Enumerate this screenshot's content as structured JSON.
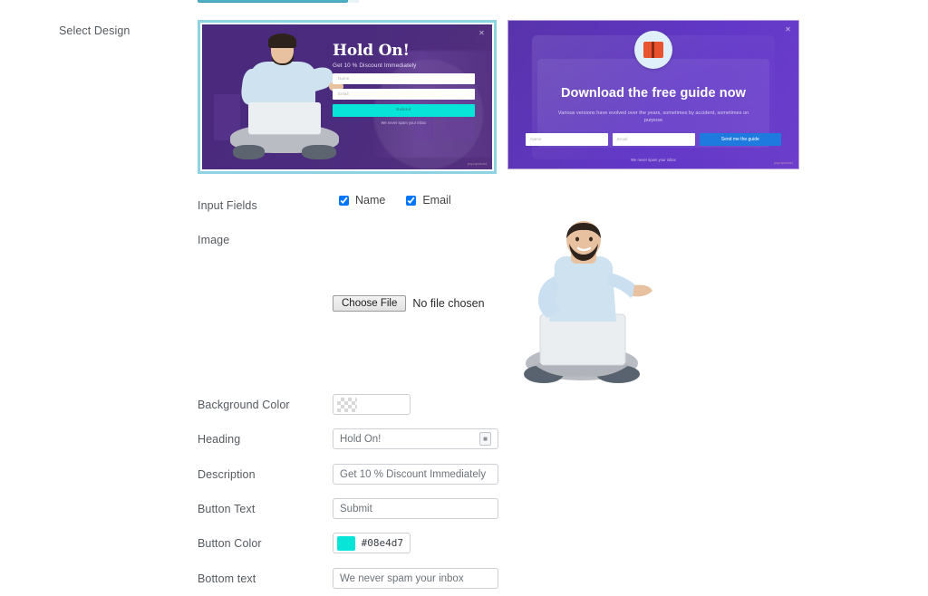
{
  "labels": {
    "select_design": "Select Design",
    "input_fields": "Input Fields",
    "image": "Image",
    "background_color": "Background Color",
    "heading": "Heading",
    "description": "Description",
    "button_text": "Button Text",
    "button_color": "Button Color",
    "bottom_text": "Bottom text"
  },
  "input_fields": {
    "name_label": "Name",
    "email_label": "Email",
    "name_checked": true,
    "email_checked": true
  },
  "image_upload": {
    "button_label": "Choose File",
    "status": "No file chosen",
    "preview_alt": "Man sitting cross-legged with laptop presenting with one hand"
  },
  "fields": {
    "background_color_value": "",
    "background_color_swatch": "transparent",
    "heading_value": "Hold On!",
    "heading_emoji_icon": "emoji-picker-icon",
    "description_value": "Get 10 % Discount Immediately",
    "button_text_value": "Submit",
    "button_color_value": "#08e4d7",
    "bottom_text_value": "We never spam your inbox"
  },
  "designs": [
    {
      "name": "design-1",
      "selected": true,
      "selection_color": "#8fd3e3",
      "background_color": "#4b2a7d",
      "heading": "Hold On!",
      "description": "Get 10 % Discount Immediately",
      "name_placeholder": "Name",
      "email_placeholder": "Email",
      "button_text": "Submit",
      "button_color": "#08e4d7",
      "bottom_text": "We never spam your inbox",
      "close_icon": "close-icon",
      "watermark": "popupsmart"
    },
    {
      "name": "design-2",
      "selected": false,
      "background_color": "#5f34c8",
      "heading": "Download the free guide now",
      "description": "Various versions have evolved over the years, sometimes by accident, sometimes on purpose",
      "name_placeholder": "Name",
      "email_placeholder": "Email",
      "button_text": "Send me the guide",
      "button_color": "#1f7ae0",
      "bottom_text": "We never spam your inbox",
      "badge_icon": "open-book-icon",
      "close_icon": "close-icon",
      "watermark": "popupsmart"
    }
  ]
}
